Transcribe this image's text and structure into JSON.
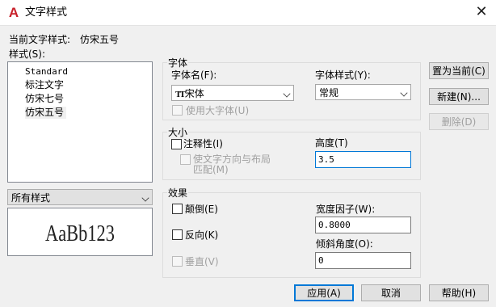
{
  "window": {
    "title": "文字样式",
    "app_icon_glyph": "A",
    "close_glyph": "✕"
  },
  "current_style": {
    "label": "当前文字样式:",
    "value": "仿宋五号"
  },
  "styles": {
    "label": "样式(S):",
    "items": [
      "Standard",
      "标注文字",
      "仿宋七号",
      "仿宋五号"
    ],
    "selected_index": 3,
    "filter": "所有样式"
  },
  "preview": {
    "text": "AaBb123"
  },
  "font": {
    "group_title": "字体",
    "name_label": "字体名(F):",
    "name_value": "宋体",
    "name_icon": "truetype-font-icon",
    "style_label": "字体样式(Y):",
    "style_value": "常规",
    "bigfont_label": "使用大字体(U)",
    "bigfont_checked": false
  },
  "size": {
    "group_title": "大小",
    "annotative_label": "注释性(I)",
    "annotative_checked": false,
    "match_orientation_line1": "使文字方向与布局",
    "match_orientation_line2": "匹配(M)",
    "height_label": "高度(T)",
    "height_value": "3.5"
  },
  "effects": {
    "group_title": "效果",
    "upside_down_label": "颠倒(E)",
    "backwards_label": "反向(K)",
    "vertical_label": "垂直(V)",
    "width_factor_label": "宽度因子(W):",
    "width_factor_value": "0.8000",
    "oblique_label": "倾斜角度(O):",
    "oblique_value": "0"
  },
  "buttons": {
    "set_current": "置为当前(C)",
    "new": "新建(N)...",
    "delete": "删除(D)",
    "apply": "应用(A)",
    "cancel": "取消",
    "help": "帮助(H)"
  },
  "colors": {
    "accent": "#0078d7",
    "app_icon": "#c8202a",
    "dialog_bg": "#f0f0f0"
  }
}
